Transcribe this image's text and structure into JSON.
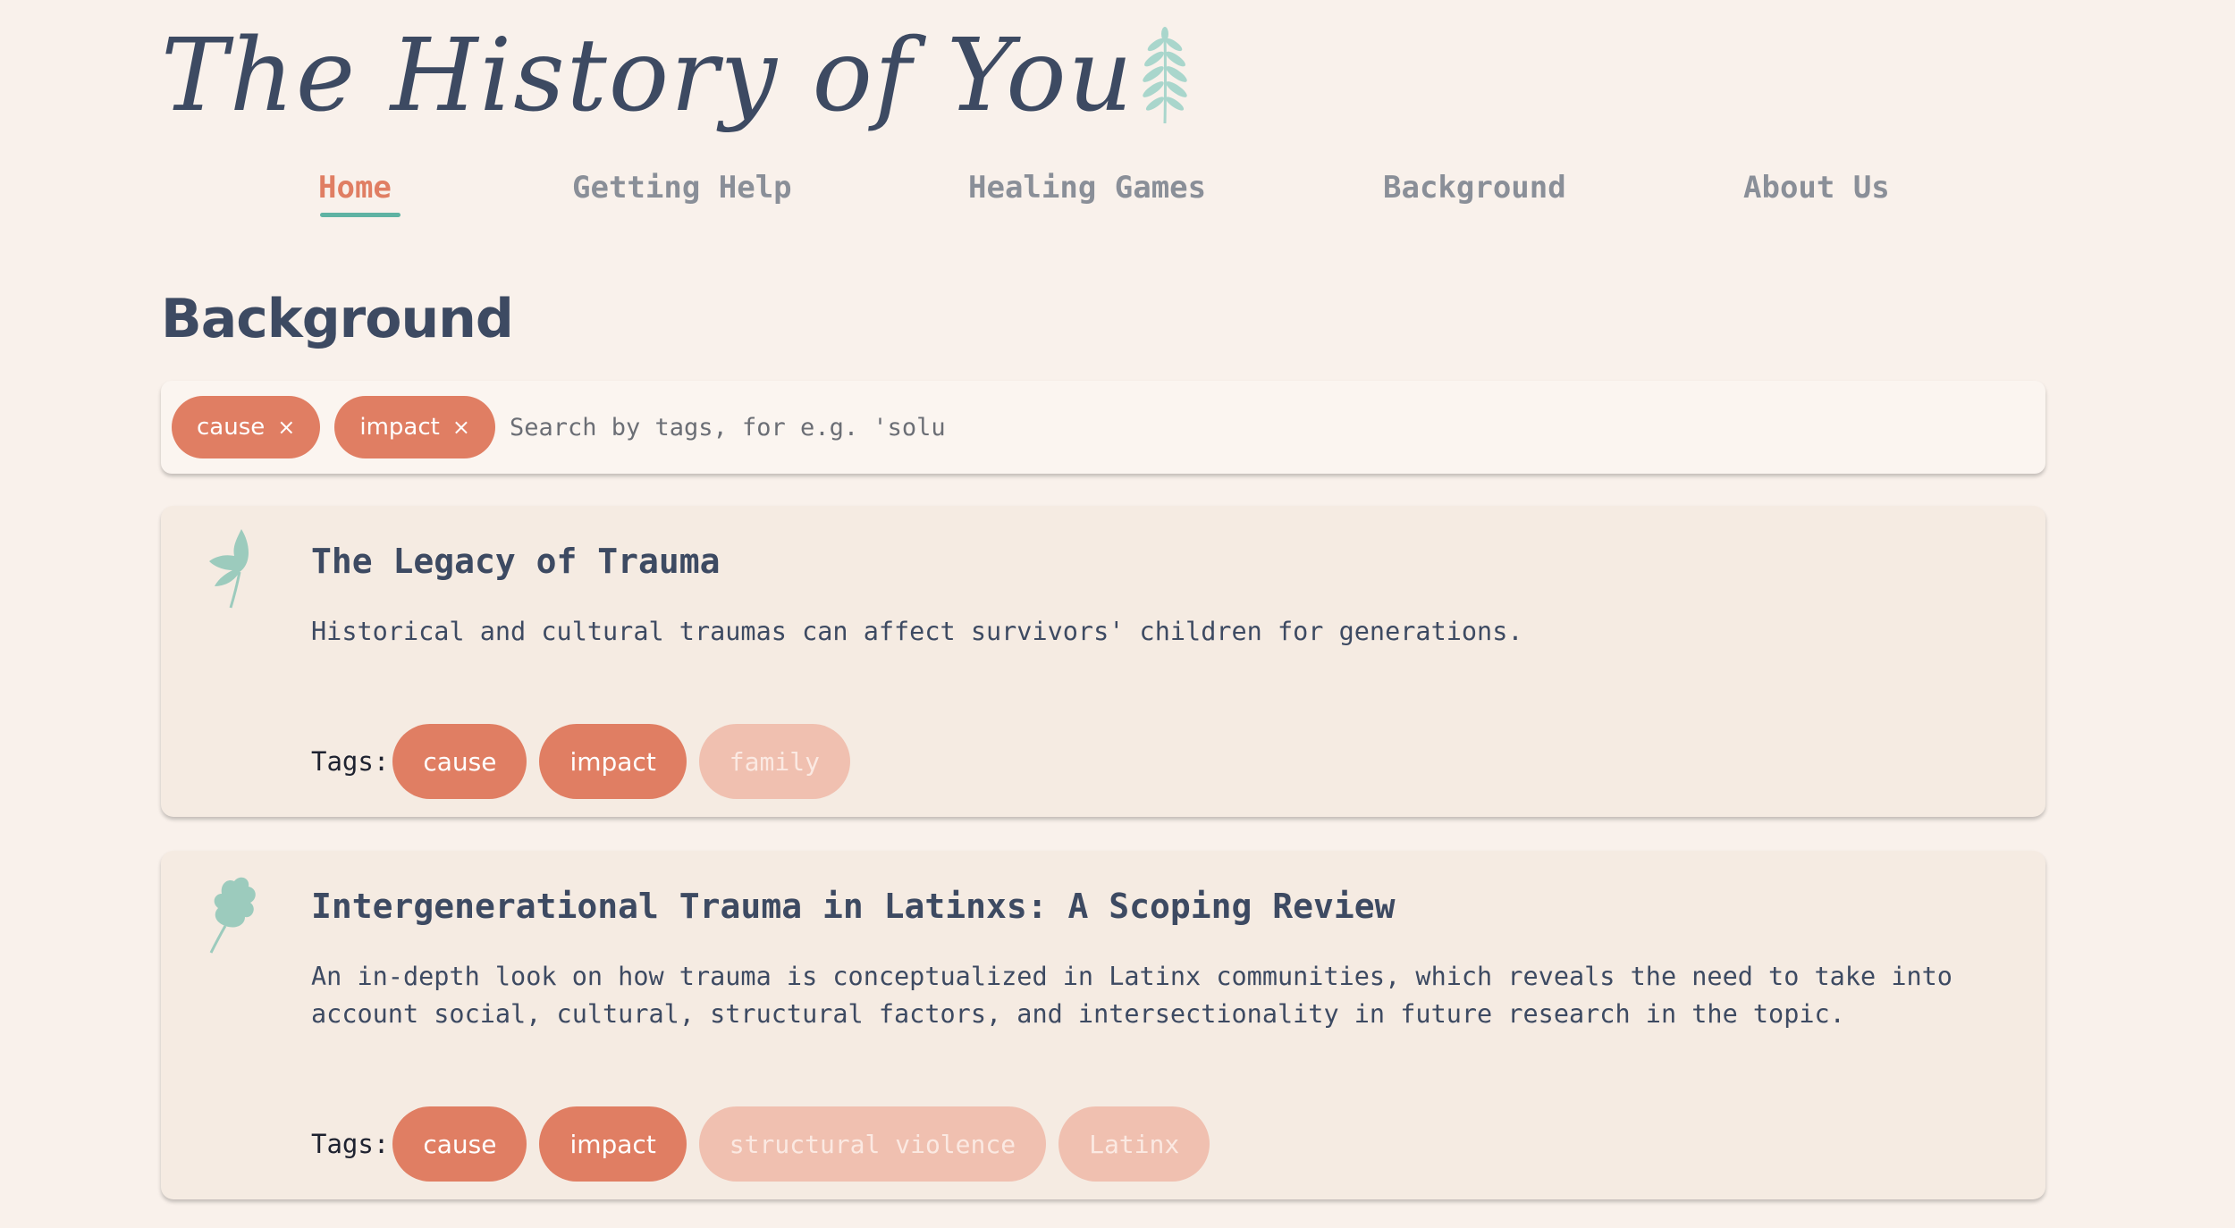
{
  "header": {
    "logo_text": "The History of You"
  },
  "nav": {
    "items": [
      {
        "label": "Home",
        "active": true
      },
      {
        "label": "Getting Help",
        "active": false
      },
      {
        "label": "Healing Games",
        "active": false
      },
      {
        "label": "Background",
        "active": false
      },
      {
        "label": "About Us",
        "active": false
      }
    ]
  },
  "page": {
    "title": "Background"
  },
  "search": {
    "chips": [
      "cause",
      "impact"
    ],
    "chip_remove": "×",
    "placeholder": "Search by tags, for e.g. 'solu"
  },
  "cards": [
    {
      "title": "The Legacy of Trauma",
      "description": "Historical and cultural traumas can affect survivors' children for generations.",
      "tags_label": "Tags:",
      "tags": [
        {
          "label": "cause",
          "selected": true
        },
        {
          "label": "impact",
          "selected": true
        },
        {
          "label": "family",
          "selected": false
        }
      ],
      "icon": "leaf-icon"
    },
    {
      "title": "Intergenerational Trauma in Latinxs: A Scoping Review",
      "description": "An in-depth look on how trauma is conceptualized in Latinx communities, which reveals the need to take into account social, cultural, structural factors, and intersectionality in future research in the topic.",
      "tags_label": "Tags:",
      "tags": [
        {
          "label": "cause",
          "selected": true
        },
        {
          "label": "impact",
          "selected": true
        },
        {
          "label": "structural violence",
          "selected": false
        },
        {
          "label": "Latinx",
          "selected": false
        }
      ],
      "icon": "oak-leaf-icon"
    }
  ],
  "colors": {
    "background": "#f9f1eb",
    "card": "#f5ebe2",
    "accent": "#e07e63",
    "accent_light": "#f0c0b0",
    "teal": "#5fb3a3",
    "text": "#3d4a62",
    "nav_text": "#8a8f98"
  }
}
